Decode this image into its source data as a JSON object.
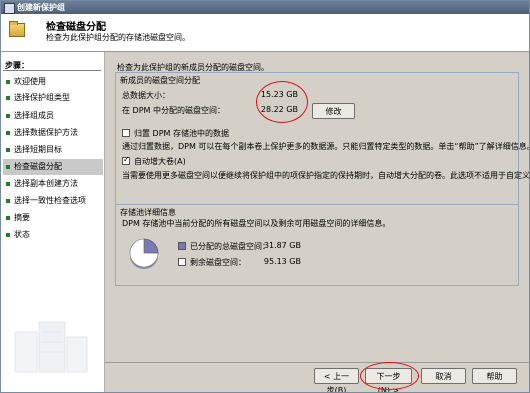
{
  "window": {
    "title": "创建新保护组"
  },
  "header": {
    "title": "检查磁盘分配",
    "subtitle": "检查为此保护组分配的存储池磁盘空间。"
  },
  "nav": {
    "title": "步骤：",
    "items": [
      {
        "label": "欢迎使用"
      },
      {
        "label": "选择保护组类型"
      },
      {
        "label": "选择组成员"
      },
      {
        "label": "选择数据保护方法"
      },
      {
        "label": "选择短期目标"
      },
      {
        "label": "检查磁盘分配"
      },
      {
        "label": "选择副本创建方法"
      },
      {
        "label": "选择一致性检查选项"
      },
      {
        "label": "摘要"
      },
      {
        "label": "状态"
      }
    ],
    "active_index": 5
  },
  "main": {
    "intro": "检查为此保护组的新成员分配的磁盘空间。",
    "alloc_group": {
      "title": "新成员的磁盘空间分配",
      "total_label": "总数据大小：",
      "total_value": "15.23 GB",
      "dpm_label": "在 DPM 中分配的磁盘空间：",
      "dpm_value": "28.22 GB",
      "modify_button": "修改",
      "colocate_label": "归置 DPM 存储池中的数据",
      "colocate_checked": false,
      "colocate_desc": "通过归置数据，DPM 可以在每个副本卷上保护更多的数据源。只能归置特定类型的数据。单击“帮助”了解详细信息。",
      "autogrow_label": "自动增大卷(A)",
      "autogrow_checked": true,
      "autogrow_desc": "当需要使用更多磁盘空间以便继续将保护组中的项保护指定的保持期时，自动增大分配的卷。此选项不适用于自定义卷。"
    },
    "storage_group": {
      "title": "存储池详细信息",
      "desc": "DPM 存储池中当前分配的所有磁盘空间以及剩余可用磁盘空间的详细信息。",
      "allocated_label": "已分配的总磁盘空间：",
      "allocated_value": "31.87 GB",
      "free_label": "剩余磁盘空间：",
      "free_value": "95.13 GB",
      "pie": {
        "allocated": 31.87,
        "free": 95.13
      },
      "colors": {
        "allocated": "#7b7bb4",
        "free": "#ffffff"
      }
    }
  },
  "footer": {
    "back_button": "< 上一步(B)",
    "next_button": "下一步(N) >",
    "cancel_button": "取消",
    "help_button": "帮助"
  },
  "colors": {
    "annotation": "#e01010",
    "title_bar": "#5a6c86",
    "nav_bullet": "#2a7a2a"
  }
}
